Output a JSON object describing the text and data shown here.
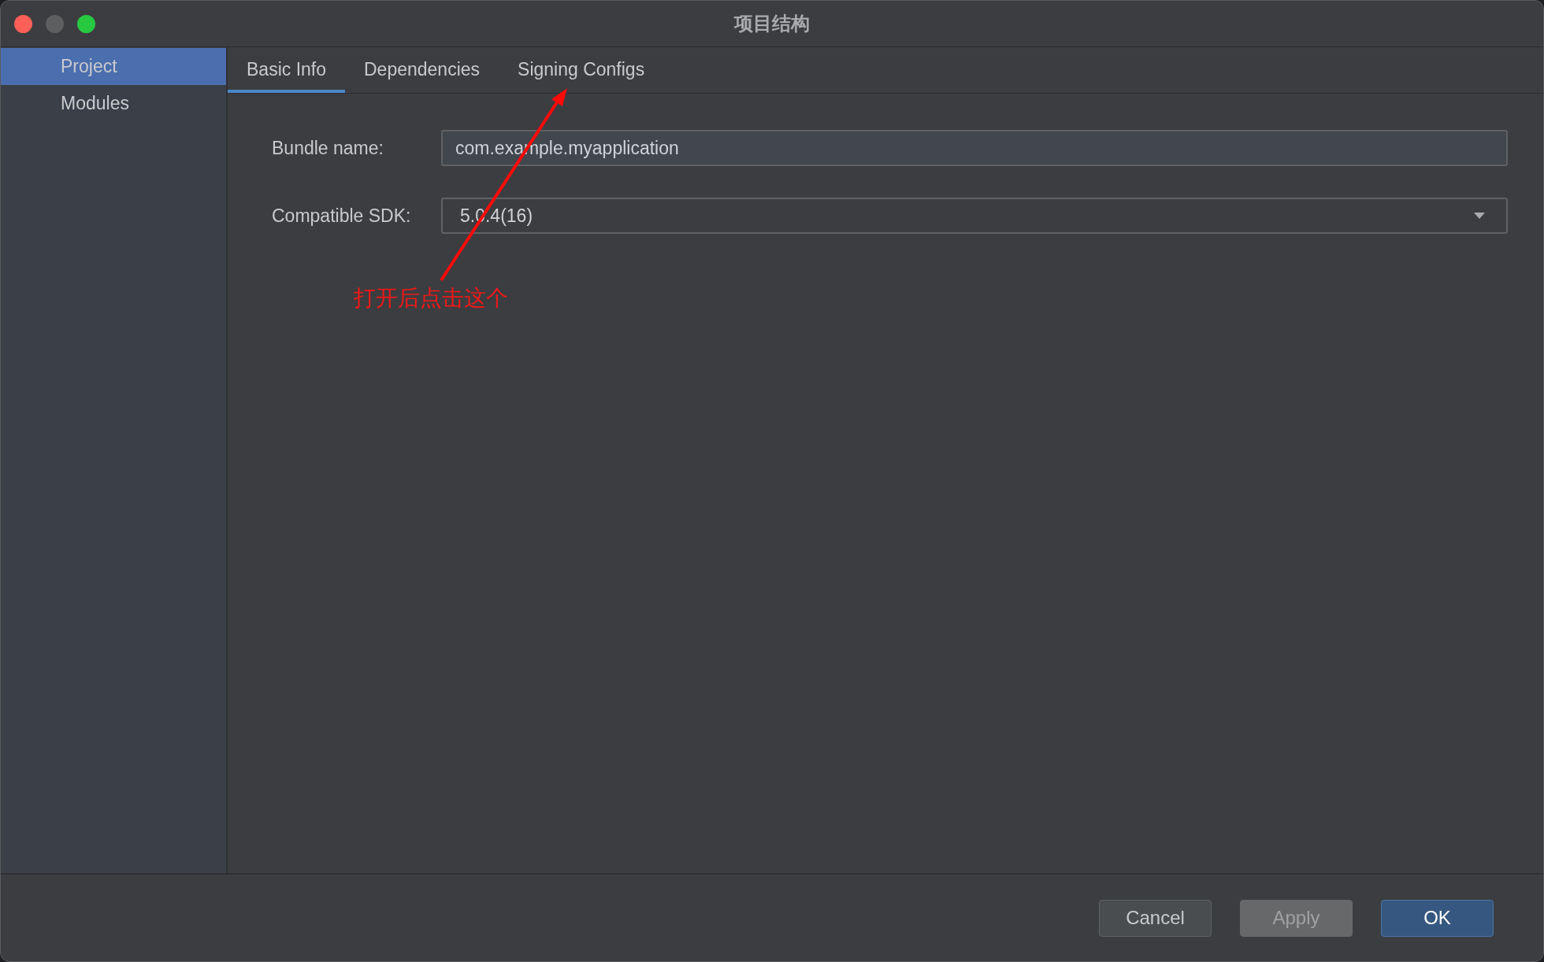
{
  "window": {
    "title": "项目结构"
  },
  "sidebar": {
    "items": [
      {
        "label": "Project",
        "selected": true
      },
      {
        "label": "Modules",
        "selected": false
      }
    ]
  },
  "tabs": [
    {
      "label": "Basic Info",
      "selected": true
    },
    {
      "label": "Dependencies",
      "selected": false
    },
    {
      "label": "Signing Configs",
      "selected": false
    }
  ],
  "fields": [
    {
      "kind": "text",
      "label": "Bundle name:",
      "value": "com.example.myapplication"
    },
    {
      "kind": "dropdown",
      "label": "Compatible SDK:",
      "value": "5.0.4(16)"
    }
  ],
  "annotation": {
    "text": "打开后点击这个"
  },
  "buttons": [
    {
      "label": "Cancel",
      "kind": "default",
      "disabled": false
    },
    {
      "label": "Apply",
      "kind": "default",
      "disabled": true
    },
    {
      "label": "OK",
      "kind": "primary",
      "disabled": false
    }
  ]
}
